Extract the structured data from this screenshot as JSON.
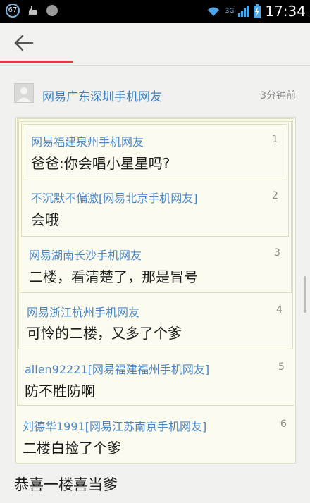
{
  "statusbar": {
    "notif_badge": "67",
    "network": "3G",
    "time": "17:34"
  },
  "post": {
    "username": "网易广东深圳手机网友",
    "time": "3分钟前",
    "main_text": "恭喜一楼喜当爹"
  },
  "comments": [
    {
      "user": "网易福建泉州手机网友",
      "text": "爸爸:你会唱小星星吗?",
      "floor": "1"
    },
    {
      "user": "不沉默不偏激[网易北京手机网友]",
      "text": "会哦",
      "floor": "2"
    },
    {
      "user": "网易湖南长沙手机网友",
      "text": "二楼，看清楚了，那是冒号",
      "floor": "3"
    },
    {
      "user": "网易浙江杭州手机网友",
      "text": "可怜的二楼，又多了个爹",
      "floor": "4"
    },
    {
      "user": "allen92221[网易福建福州手机网友]",
      "text": "防不胜防啊",
      "floor": "5"
    },
    {
      "user": "刘德华1991[网易江苏南京手机网友]",
      "text": "二楼白捡了个爹",
      "floor": "6"
    }
  ],
  "colors": {
    "accent": "#d9453a",
    "username": "#4a86c5",
    "quote_bg": "#fbfbef"
  }
}
